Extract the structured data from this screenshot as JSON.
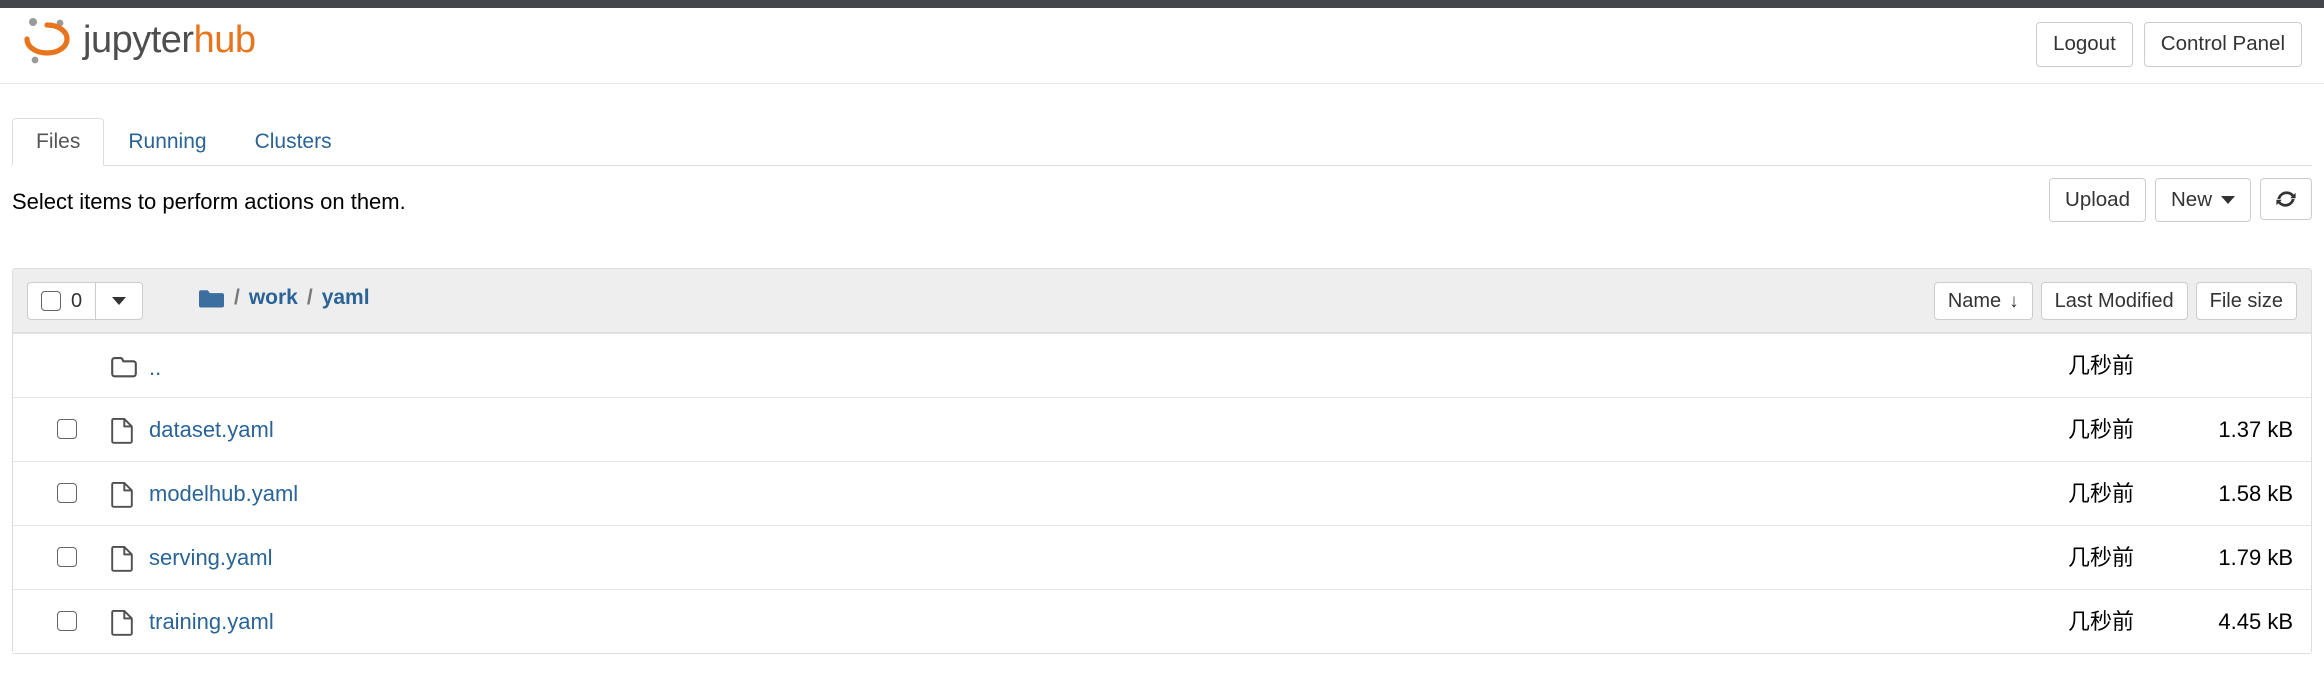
{
  "header": {
    "brand_jupyter": "jupyter",
    "brand_hub": "hub",
    "logout_label": "Logout",
    "control_panel_label": "Control Panel"
  },
  "tabs": [
    {
      "label": "Files",
      "active": true
    },
    {
      "label": "Running",
      "active": false
    },
    {
      "label": "Clusters",
      "active": false
    }
  ],
  "actions": {
    "select_hint": "Select items to perform actions on them.",
    "upload_label": "Upload",
    "new_label": "New",
    "refresh_label": "⟳"
  },
  "breadcrumb": {
    "selected_count": "0",
    "path": [
      "work",
      "yaml"
    ],
    "separator": "/"
  },
  "sort": {
    "name_label": "Name",
    "name_arrow": "↓",
    "last_modified_label": "Last Modified",
    "file_size_label": "File size"
  },
  "files": [
    {
      "name": "..",
      "type": "parent",
      "modified": "几秒前",
      "size": ""
    },
    {
      "name": "dataset.yaml",
      "type": "file",
      "modified": "几秒前",
      "size": "1.37 kB"
    },
    {
      "name": "modelhub.yaml",
      "type": "file",
      "modified": "几秒前",
      "size": "1.58 kB"
    },
    {
      "name": "serving.yaml",
      "type": "file",
      "modified": "几秒前",
      "size": "1.79 kB"
    },
    {
      "name": "training.yaml",
      "type": "file",
      "modified": "几秒前",
      "size": "4.45 kB"
    }
  ],
  "colors": {
    "accent_orange": "#e8741e",
    "link_blue": "#2a6496",
    "folder_blue": "#3c6e9f",
    "top_strip": "#43464b",
    "panel_head_bg": "#eeeeee"
  }
}
